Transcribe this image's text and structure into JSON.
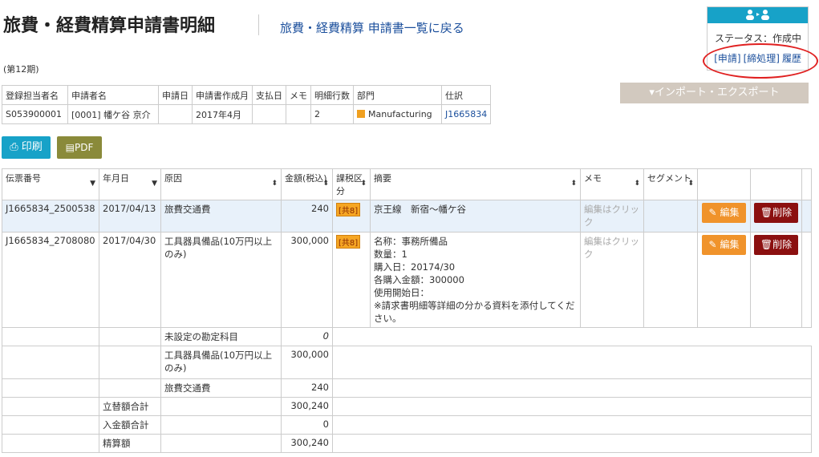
{
  "header": {
    "title": "旅費・経費精算申請書明細",
    "back_link": "旅費・経費精算 申請書一覧に戻る",
    "period": "(第12期)"
  },
  "status": {
    "header_icon": "users-icon",
    "text": "ステータス：作成中",
    "links": [
      "[申請]",
      "[締処理]",
      "履歴"
    ]
  },
  "import_export_label": "▾インポート・エクスポート",
  "info_table": {
    "headers": [
      "登録担当者名",
      "申請者名",
      "申請日",
      "申請書作成月",
      "支払日",
      "メモ",
      "明細行数",
      "部門",
      "仕訳"
    ],
    "row": [
      "S053900001",
      "[0001] 幡ケ谷 京介",
      "",
      "2017年4月",
      "",
      "",
      "2",
      "Manufacturing",
      "J1665834"
    ]
  },
  "buttons": {
    "print": "印刷",
    "pdf": "PDF"
  },
  "main_table": {
    "headers": [
      "伝票番号",
      "年月日",
      "原因",
      "金額(税込)",
      "課税区分",
      "摘要",
      "メモ",
      "セグメント"
    ],
    "rows": [
      {
        "slip": "J1665834_2500538",
        "date": "2017/04/13",
        "cause": "旅費交通費",
        "amount": "240",
        "tax": "[共8]",
        "summary": [
          "京王線　新宿～幡ケ谷"
        ],
        "memo": "編集はクリック",
        "segment": "",
        "edit": "編集",
        "delete": "削除"
      },
      {
        "slip": "J1665834_2708080",
        "date": "2017/04/30",
        "cause": "工具器具備品(10万円以上のみ)",
        "amount": "300,000",
        "tax": "[共8]",
        "summary": [
          "名称：事務所備品",
          "数量：1",
          "購入日：20174/30",
          "各購入金額：300000",
          "使用開始日：",
          "※請求書明細等詳細の分かる資料を添付してください。"
        ],
        "memo": "編集はクリック",
        "segment": "",
        "edit": "編集",
        "delete": "削除"
      }
    ],
    "subtotals": [
      {
        "label": "未設定の勘定科目",
        "value": "0"
      },
      {
        "label": "工具器具備品(10万円以上のみ)",
        "value": "300,000"
      },
      {
        "label": "旅費交通費",
        "value": "240"
      }
    ],
    "totals": [
      {
        "label": "立替額合計",
        "value": "300,240"
      },
      {
        "label": "入金額合計",
        "value": "0"
      },
      {
        "label": "精算額",
        "value": "300,240"
      }
    ]
  },
  "colors": {
    "accent": "#17a2c8",
    "edit": "#f0932b",
    "delete": "#8b1010",
    "highlight_circle": "#e02020"
  }
}
